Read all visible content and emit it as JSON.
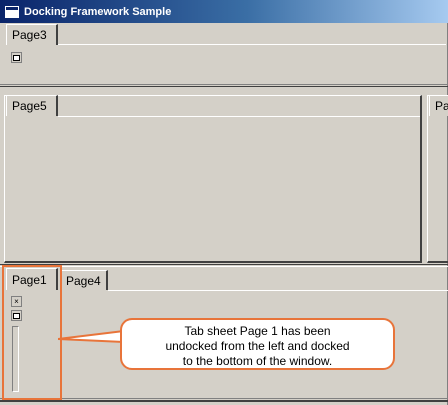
{
  "window": {
    "title": "Docking Framework Sample"
  },
  "top_panel": {
    "tab": "Page3"
  },
  "middle_panel": {
    "left_tab": "Page5",
    "right_tab": "Pa"
  },
  "bottom_panel": {
    "tabs": [
      "Page1",
      "Page4"
    ],
    "close_glyph": "×"
  },
  "callout": {
    "lines": [
      "Tab sheet Page 1 has been",
      "undocked from the left and docked",
      "to the bottom of the window."
    ]
  },
  "colors": {
    "highlight": "#e8743a",
    "window_face": "#d4d0c8",
    "title_blue": "#0a246a"
  }
}
